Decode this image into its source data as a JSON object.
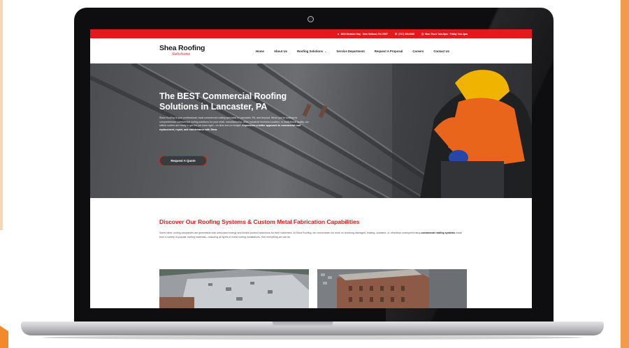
{
  "topbar": {
    "address": "1616 Division Hwy · New Holland, PA 17557",
    "phone": "(717) 355-0066",
    "hours": "Mon-Thurs 7am-5pm · Friday 7am-4pm"
  },
  "brand": {
    "name": "Shea Roofing",
    "tagline": "Solutions"
  },
  "nav": {
    "items": [
      "Home",
      "About Us",
      "Roofing Solutions",
      "Service Department",
      "Request A Proposal",
      "Careers",
      "Contact Us"
    ]
  },
  "hero": {
    "title": "The BEST Commercial Roofing Solutions in Lancaster, PA",
    "body_intro": "Shea Roofing is your professional, local commercial roofing specialist in Lancaster, PA, and beyond. When you're looking for comprehensive commercial roofing solutions for your retail, manufacturing, other industrial business location, or institutional facility, our skilled roofers are ready to get the job done right—on time and on budget.",
    "body_emphasis": "Experience a better approach to commercial roof replacement, repair, and maintenance with Shea.",
    "cta_label": "Request A Quote"
  },
  "discover": {
    "title": "Discover Our Roofing Systems & Custom Metal Fabrication Capabilities",
    "body_start": "Some other roofing companies are generalists with unfocused energy and limited product selections for their customers. At Shea Roofing, we concentrate our work on resolving damaged, leaking, outdated, or otherwise underperforming",
    "body_bold": "commercial roofing systems",
    "body_end": "made from a variety of popular roofing materials—including all types of metal roofing installations. See everything we can do."
  },
  "colors": {
    "brand_red": "#e11b1b",
    "accent_orange": "#f39a4b"
  }
}
